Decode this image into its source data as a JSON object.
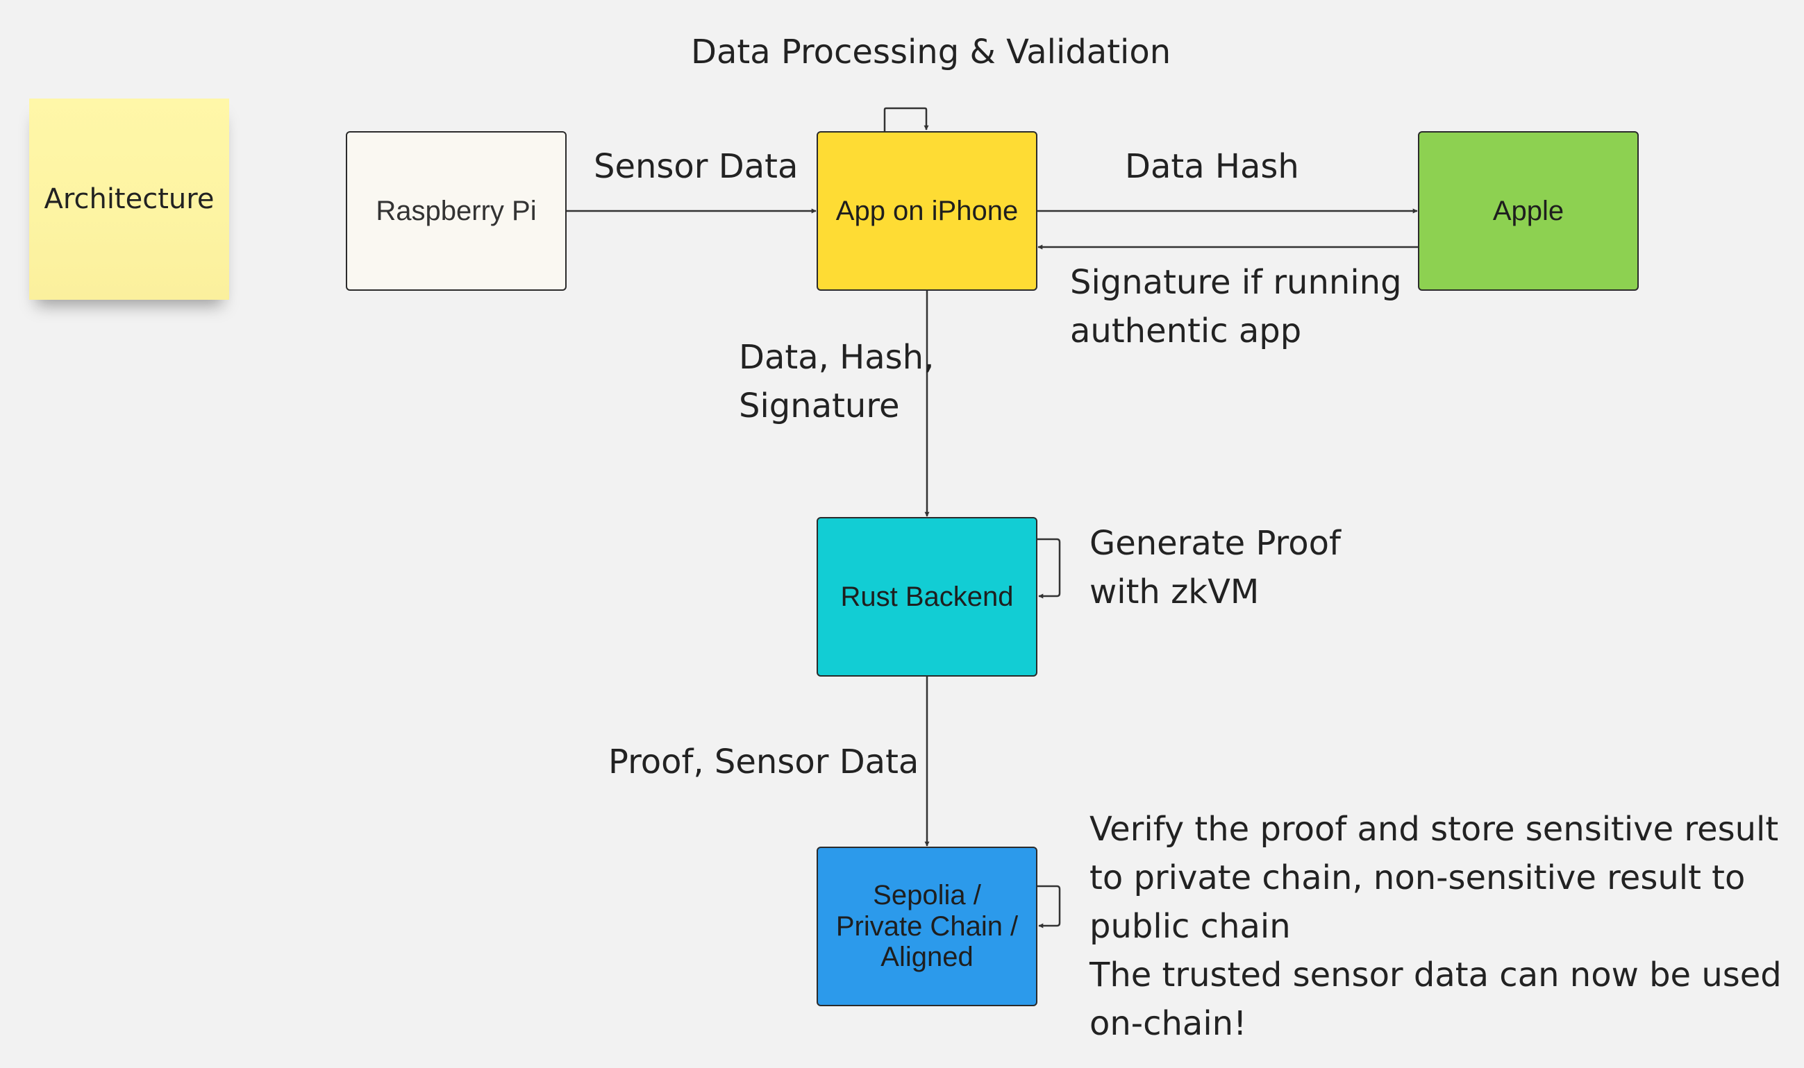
{
  "sticky_note": {
    "text": "Architecture"
  },
  "nodes": {
    "raspberry_pi": "Raspberry Pi",
    "app_on_iphone": "App on iPhone",
    "apple": "Apple",
    "rust_backend": "Rust Backend",
    "chain": "Sepolia /\nPrivate Chain /\nAligned"
  },
  "labels": {
    "data_processing": "Data Processing & Validation",
    "sensor_data": "Sensor Data",
    "data_hash": "Data Hash",
    "signature_if_authentic": "Signature if running\nauthentic app",
    "data_hash_signature": "Data, Hash,\nSignature",
    "generate_proof": "Generate Proof\nwith zkVM",
    "proof_sensor_data": "Proof, Sensor Data",
    "verify_and_store": "Verify the proof and store sensitive result\nto private chain, non-sensitive result to\npublic chain\nThe trusted sensor data can now be used\non-chain!"
  },
  "colors": {
    "background": "#f2f2f2",
    "sticky": "#fdf4a3",
    "raspberry_pi": "#faf8f2",
    "app_on_iphone": "#fedc34",
    "apple": "#8dd151",
    "rust_backend": "#12cdd4",
    "chain": "#2c9aeb",
    "edge": "#333333"
  }
}
